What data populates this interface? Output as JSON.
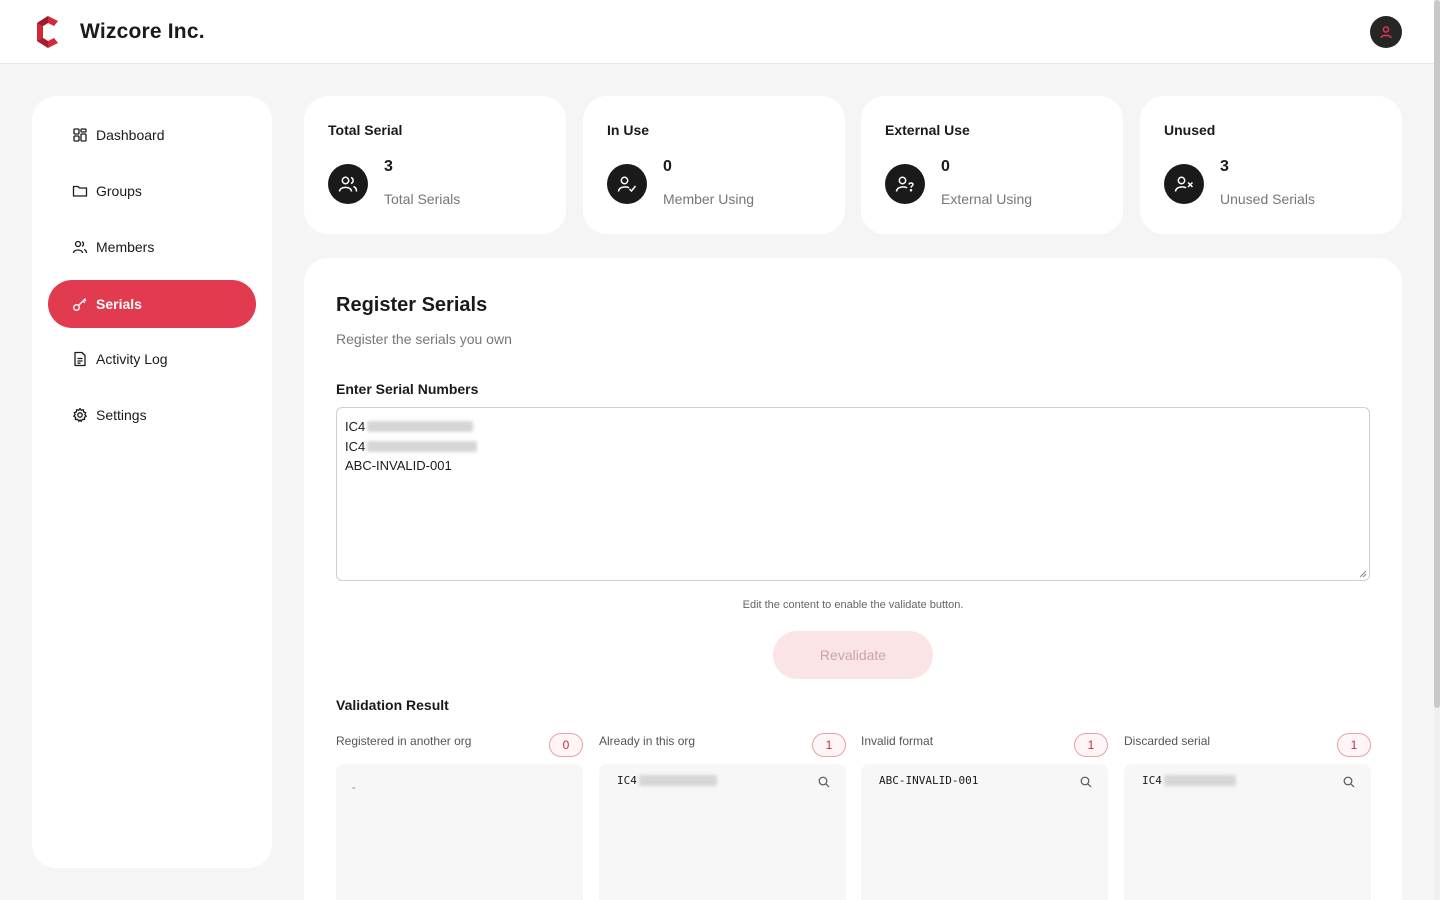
{
  "header": {
    "brand": "Wizcore Inc.",
    "logo_icon": "wizcore-logo-icon",
    "avatar_icon": "user-icon",
    "accent_color": "#e23a4e"
  },
  "sidebar": {
    "items": [
      {
        "label": "Dashboard",
        "icon": "grid-icon",
        "active": false
      },
      {
        "label": "Groups",
        "icon": "folder-icon",
        "active": false
      },
      {
        "label": "Members",
        "icon": "users-icon",
        "active": false
      },
      {
        "label": "Serials",
        "icon": "key-icon",
        "active": true
      },
      {
        "label": "Activity Log",
        "icon": "document-icon",
        "active": false
      },
      {
        "label": "Settings",
        "icon": "gear-icon",
        "active": false
      }
    ]
  },
  "stats": [
    {
      "title": "Total Serial",
      "value": "3",
      "sub": "Total Serials",
      "icon": "users-icon"
    },
    {
      "title": "In Use",
      "value": "0",
      "sub": "Member Using",
      "icon": "user-check-icon"
    },
    {
      "title": "External Use",
      "value": "0",
      "sub": "External Using",
      "icon": "user-question-icon"
    },
    {
      "title": "Unused",
      "value": "3",
      "sub": "Unused Serials",
      "icon": "user-x-icon"
    }
  ],
  "register": {
    "title": "Register Serials",
    "subtitle": "Register the serials you own",
    "field_label": "Enter Serial Numbers",
    "lines": [
      "IC4",
      "IC4",
      "ABC-INVALID-001"
    ],
    "hint": "Edit the content to enable the validate button.",
    "revalidate_label": "Revalidate"
  },
  "validation": {
    "title": "Validation Result",
    "columns": [
      {
        "label": "Registered in another org",
        "count": "0",
        "items": [],
        "empty": "-"
      },
      {
        "label": "Already in this org",
        "count": "1",
        "items": [
          "IC4"
        ]
      },
      {
        "label": "Invalid format",
        "count": "1",
        "items": [
          "ABC-INVALID-001"
        ]
      },
      {
        "label": "Discarded serial",
        "count": "1",
        "items": [
          "IC4"
        ]
      }
    ]
  }
}
